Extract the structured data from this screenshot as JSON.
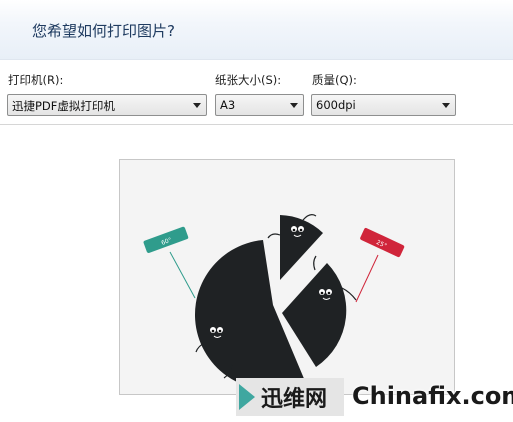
{
  "dialog": {
    "title": "您希望如何打印图片?"
  },
  "printer": {
    "label": "打印机(R):",
    "value": "迅捷PDF虚拟打印机"
  },
  "paper_size": {
    "label": "纸张大小(S):",
    "value": "A3"
  },
  "quality": {
    "label": "质量(Q):",
    "value": "600dpi"
  },
  "preview": {
    "description": "pie chart illustration",
    "colors": {
      "pie": "#1f2224",
      "green_sign": "#2f9c8c",
      "red_sign": "#d0253a"
    },
    "green_sign_text": "60°",
    "red_sign_text": "25°"
  },
  "watermark": {
    "cn": "迅维网",
    "en": "Chinafix.com"
  }
}
